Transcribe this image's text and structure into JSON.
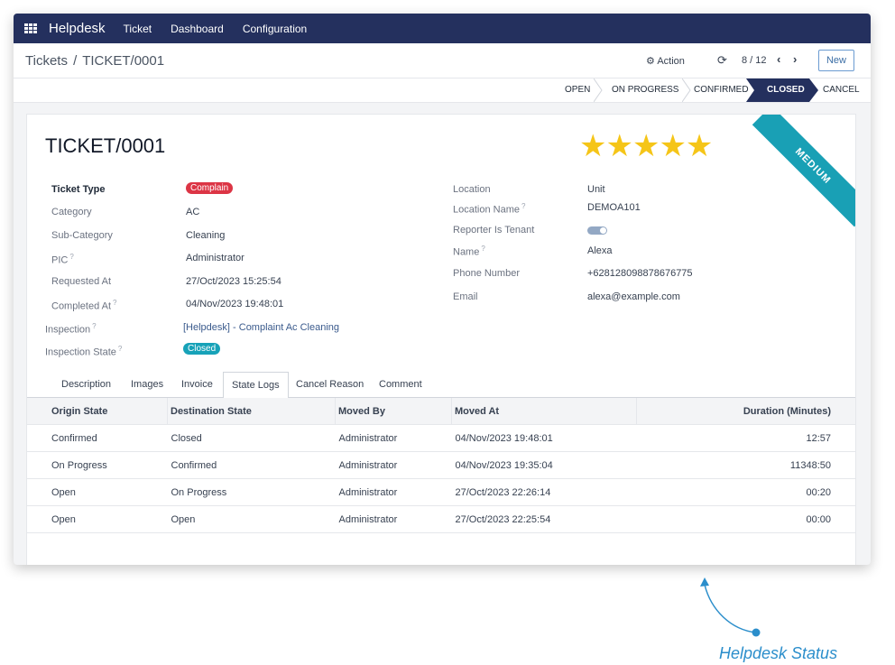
{
  "nav": {
    "brand": "Helpdesk",
    "items": [
      "Ticket",
      "Dashboard",
      "Configuration"
    ]
  },
  "breadcrumb": {
    "parent": "Tickets",
    "separator": "/",
    "current": "TICKET/0001"
  },
  "toolbar": {
    "action_label": "Action",
    "pager": "8 / 12",
    "new_label": "New"
  },
  "stages": {
    "open": "OPEN",
    "on_progress": "ON PROGRESS",
    "confirmed": "CONFIRMED",
    "closed": "CLOSED",
    "cancel": "CANCEL"
  },
  "ticket": {
    "title": "TICKET/0001",
    "rating_stars": 5,
    "rating_max": 5,
    "stars": "★★★★★",
    "ribbon": "MEDIUM"
  },
  "fields_left": {
    "ticket_type_label": "Ticket Type",
    "ticket_type": "Complain",
    "category_label": "Category",
    "category": "AC",
    "subcategory_label": "Sub-Category",
    "subcategory": "Cleaning",
    "pic_label": "PIC",
    "pic": "Administrator",
    "requested_at_label": "Requested At",
    "requested_at": "27/Oct/2023 15:25:54",
    "completed_at_label": "Completed At",
    "completed_at": "04/Nov/2023 19:48:01",
    "inspection_label": "Inspection",
    "inspection": "[Helpdesk] - Complaint Ac Cleaning",
    "inspection_state_label": "Inspection State",
    "inspection_state": "Closed"
  },
  "fields_right": {
    "location_label": "Location",
    "location": "Unit",
    "location_name_label": "Location Name",
    "location_name": "DEMOA101",
    "reporter_is_tenant_label": "Reporter Is Tenant",
    "reporter_is_tenant": true,
    "name_label": "Name",
    "name": "Alexa",
    "phone_label": "Phone Number",
    "phone": "+628128098878676775",
    "email_label": "Email",
    "email": "alexa@example.com"
  },
  "help_mark": "?",
  "tabs": [
    "Description",
    "Images",
    "Invoice",
    "State Logs",
    "Cancel Reason",
    "Comment"
  ],
  "active_tab": "State Logs",
  "state_logs": {
    "headers": [
      "Origin State",
      "Destination State",
      "Moved By",
      "Moved At",
      "Duration (Minutes)"
    ],
    "rows": [
      [
        "Confirmed",
        "Closed",
        "Administrator",
        "04/Nov/2023 19:48:01",
        "12:57"
      ],
      [
        "On Progress",
        "Confirmed",
        "Administrator",
        "04/Nov/2023 19:35:04",
        "11348:50"
      ],
      [
        "Open",
        "On Progress",
        "Administrator",
        "27/Oct/2023 22:26:14",
        "00:20"
      ],
      [
        "Open",
        "Open",
        "Administrator",
        "27/Oct/2023 22:25:54",
        "00:00"
      ]
    ]
  },
  "annotation": "Helpdesk Status",
  "colors": {
    "nav": "#24305e",
    "ribbon": "#19a0b5",
    "badge_red": "#dc3545",
    "badge_teal": "#17a2b8",
    "star": "#f5c518",
    "annotation": "#2b8ecb"
  }
}
